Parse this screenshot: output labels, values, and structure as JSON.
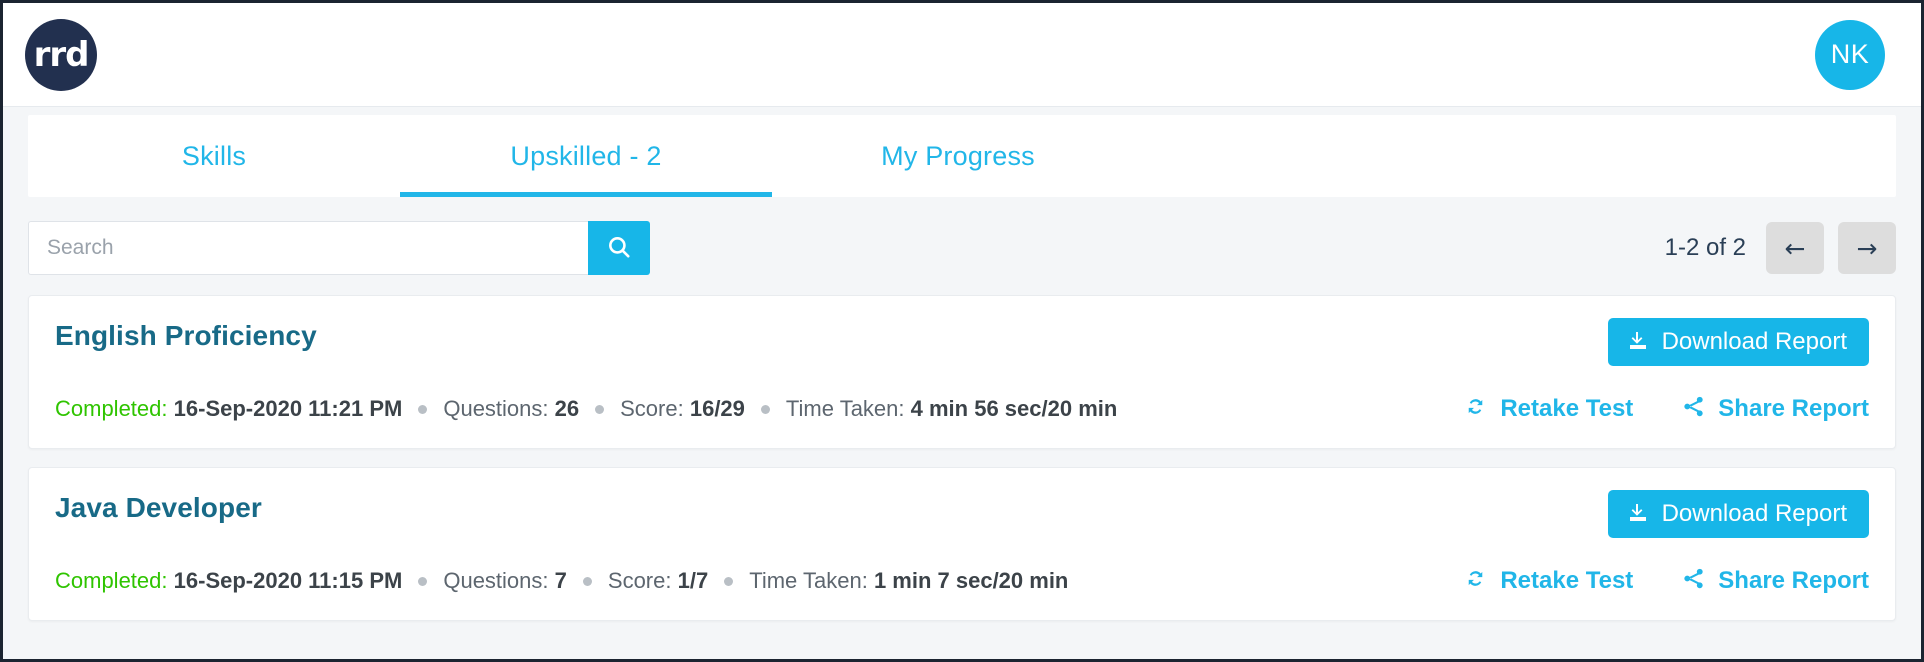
{
  "header": {
    "logo_text": "rrd",
    "logo_color": "#22304f",
    "avatar_initials": "NK",
    "avatar_color": "#17b6e8"
  },
  "tabs": [
    {
      "label": "Skills",
      "active": false
    },
    {
      "label": "Upskilled - 2",
      "active": true
    },
    {
      "label": "My Progress",
      "active": false
    }
  ],
  "toolbar": {
    "search_placeholder": "Search",
    "search_value": "",
    "search_icon": "search-icon",
    "pagination_label": "1-2 of 2",
    "prev_label": "←",
    "next_label": "→"
  },
  "accent_color": "#21b6e8",
  "cards": [
    {
      "title": "English Proficiency",
      "download_label": "Download Report",
      "completed_key": "Completed:",
      "completed_value": "16-Sep-2020 11:21 PM",
      "questions_key": "Questions:",
      "questions_value": "26",
      "score_key": "Score:",
      "score_value": "16/29",
      "time_key": "Time Taken:",
      "time_value": "4 min 56 sec/20 min",
      "retake_label": "Retake Test",
      "share_label": "Share Report"
    },
    {
      "title": "Java Developer",
      "download_label": "Download Report",
      "completed_key": "Completed:",
      "completed_value": "16-Sep-2020 11:15 PM",
      "questions_key": "Questions:",
      "questions_value": "7",
      "score_key": "Score:",
      "score_value": "1/7",
      "time_key": "Time Taken:",
      "time_value": "1 min 7 sec/20 min",
      "retake_label": "Retake Test",
      "share_label": "Share Report"
    }
  ]
}
